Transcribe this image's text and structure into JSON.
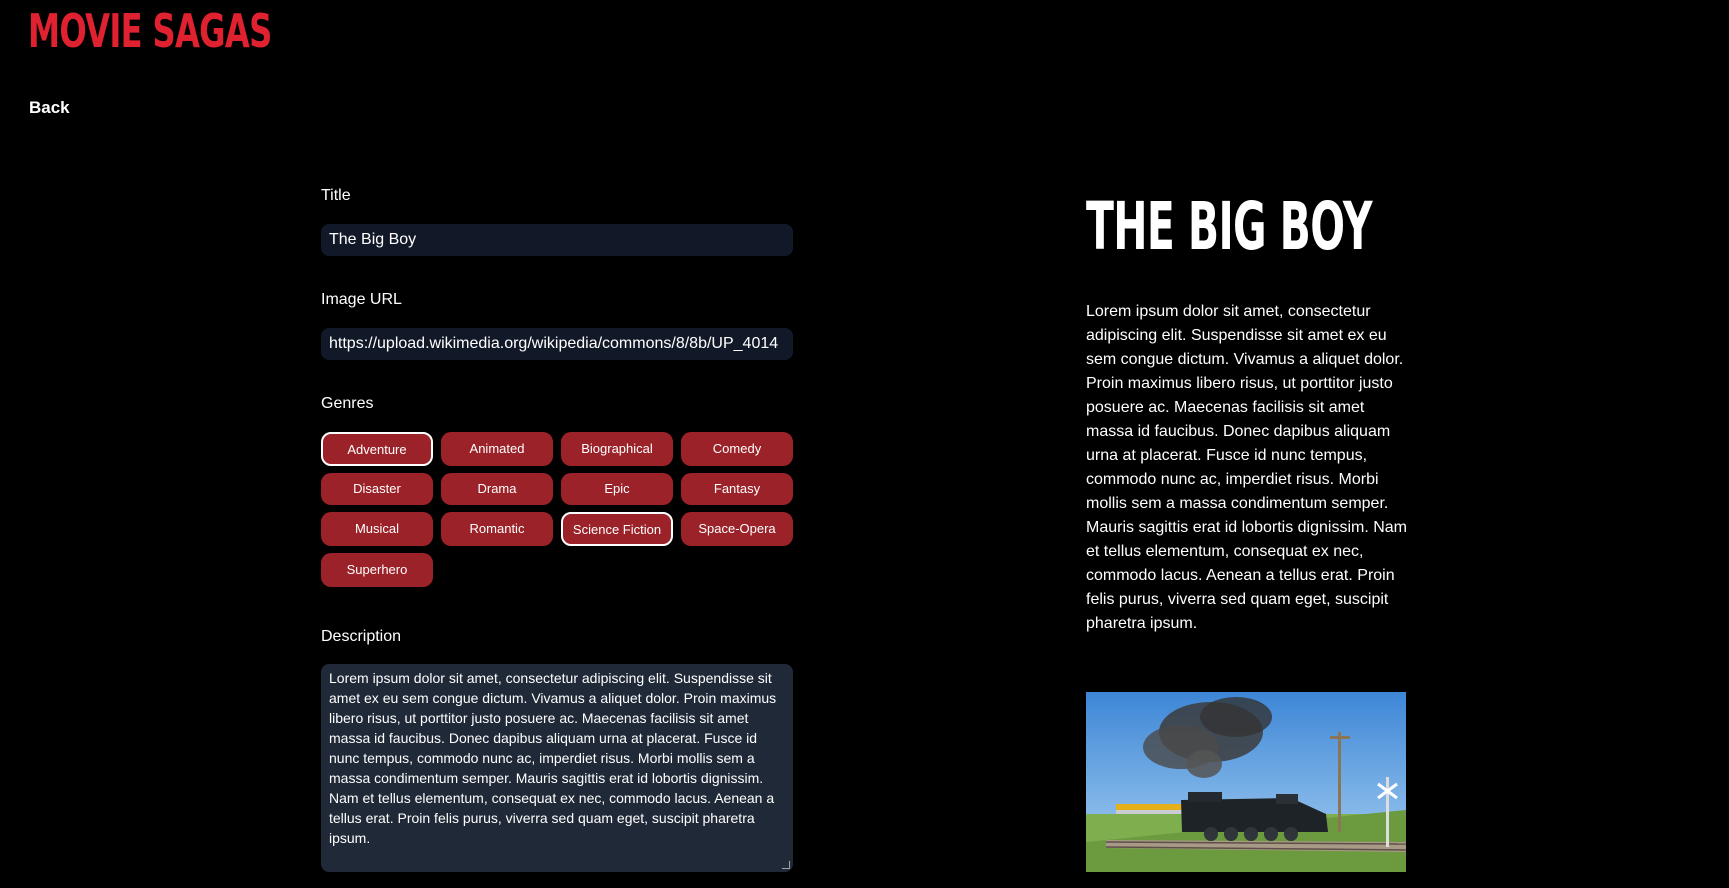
{
  "header": {
    "brand": "MOVIE SAGAS",
    "back_label": "Back"
  },
  "form": {
    "title_label": "Title",
    "title_value": "The Big Boy",
    "image_url_label": "Image URL",
    "image_url_value": "https://upload.wikimedia.org/wikipedia/commons/8/8b/UP_4014",
    "genres_label": "Genres",
    "genres": [
      {
        "label": "Adventure",
        "selected": true
      },
      {
        "label": "Animated",
        "selected": false
      },
      {
        "label": "Biographical",
        "selected": false
      },
      {
        "label": "Comedy",
        "selected": false
      },
      {
        "label": "Disaster",
        "selected": false
      },
      {
        "label": "Drama",
        "selected": false
      },
      {
        "label": "Epic",
        "selected": false
      },
      {
        "label": "Fantasy",
        "selected": false
      },
      {
        "label": "Musical",
        "selected": false
      },
      {
        "label": "Romantic",
        "selected": false
      },
      {
        "label": "Science Fiction",
        "selected": true
      },
      {
        "label": "Space-Opera",
        "selected": false
      },
      {
        "label": "Superhero",
        "selected": false
      }
    ],
    "description_label": "Description",
    "description_value": "Lorem ipsum dolor sit amet, consectetur adipiscing elit. Suspendisse sit amet ex eu sem congue dictum. Vivamus a aliquet dolor. Proin maximus libero risus, ut porttitor justo posuere ac. Maecenas facilisis sit amet massa id faucibus. Donec dapibus aliquam urna at placerat. Fusce id nunc tempus, commodo nunc ac, imperdiet risus. Morbi mollis sem a massa condimentum semper. Mauris sagittis erat id lobortis dignissim. Nam et tellus elementum, consequat ex nec, commodo lacus. Aenean a tellus erat. Proin felis purus, viverra sed quam eget, suscipit pharetra ipsum."
  },
  "preview": {
    "title": "THE BIG BOY",
    "description": "Lorem ipsum dolor sit amet, consectetur adipiscing elit. Suspendisse sit amet ex eu sem congue dictum. Vivamus a aliquet dolor. Proin maximus libero risus, ut porttitor justo posuere ac. Maecenas facilisis sit amet massa id faucibus. Donec dapibus aliquam urna at placerat. Fusce id nunc tempus, commodo nunc ac, imperdiet risus. Morbi mollis sem a massa condimentum semper. Mauris sagittis erat id lobortis dignissim. Nam et tellus elementum, consequat ex nec, commodo lacus. Aenean a tellus erat. Proin felis purus, viverra sed quam eget, suscipit pharetra ipsum."
  },
  "colors": {
    "brand": "#e0212f",
    "genre_button": "#9b2228",
    "input_bg": "#111827",
    "textarea_bg": "#1f2937",
    "page_bg": "#000000"
  }
}
